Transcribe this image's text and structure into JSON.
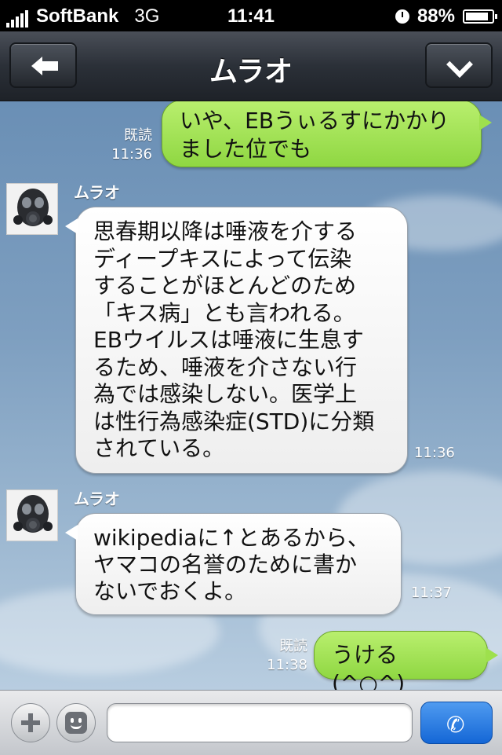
{
  "status_bar": {
    "carrier": "SoftBank",
    "network": "3G",
    "time": "11:41",
    "battery": "88%",
    "battery_level": 0.88,
    "icons": [
      "signal-icon",
      "clock-icon",
      "battery-icon"
    ]
  },
  "nav": {
    "title": "ムラオ",
    "back_icon": "back-arrow-icon",
    "menu_icon": "chevron-down-icon"
  },
  "messages": [
    {
      "dir": "out",
      "lines": [
        "いや、EBうぃるすにかかり",
        "ました位でも"
      ],
      "read": "既読",
      "time": "11:36"
    },
    {
      "dir": "in",
      "sender": "ムラオ",
      "lines": [
        "思春期以降は唾液を介する",
        "ディープキスによって伝染",
        "することがほとんどのため",
        "「キス病」とも言われる。",
        "EBウイルスは唾液に生息す",
        "るため、唾液を介さない行",
        "為では感染しない。医学上",
        "は性行為感染症(STD)に分類",
        "されている。"
      ],
      "time": "11:36"
    },
    {
      "dir": "in",
      "sender": "ムラオ",
      "lines": [
        "wikipediaに↑とあるから、",
        "ヤマコの名誉のために書か",
        "ないでおくよ。"
      ],
      "time": "11:37"
    },
    {
      "dir": "out",
      "lines": [
        "うける(^○^)"
      ],
      "read": "既読",
      "time": "11:38"
    }
  ],
  "input_bar": {
    "placeholder": "",
    "value": "",
    "icons": [
      "plus-icon",
      "emoji-icon",
      "phone-icon"
    ]
  },
  "colors": {
    "outgoing_bubble": "#9ee04d",
    "incoming_bubble": "#ffffff",
    "call_button": "#1f74e0",
    "nav_bar": "#2b3038"
  }
}
